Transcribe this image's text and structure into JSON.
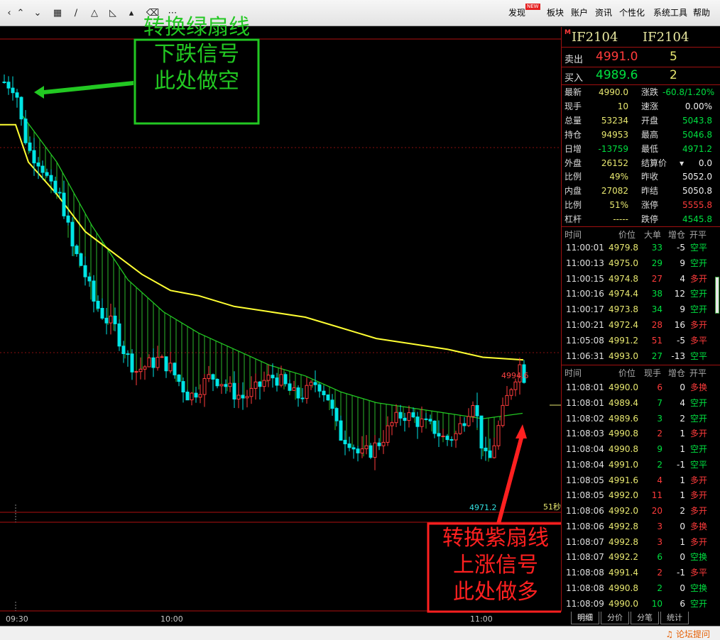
{
  "toolbar": {
    "icons": [
      "collapse-left-icon",
      "arrow-up-double-icon",
      "arrow-down-double-icon",
      "grid-icon",
      "line-draw-icon",
      "triangle-icon",
      "triangle-ruler-icon",
      "eraser-icon",
      "more-icon"
    ],
    "menus": [
      "发现",
      "板块",
      "账户",
      "资讯",
      "个性化",
      "系统工具",
      "帮助"
    ],
    "new_badge": "NEW"
  },
  "chart": {
    "time_labels": [
      "09:30",
      "10:00",
      "11:00"
    ],
    "high_label": "4994.6",
    "low_label": "4971.2",
    "countdown": "51秒",
    "colors": {
      "up": "#ff3b3b",
      "down": "#00e5e5",
      "green_line": "#22c822",
      "yellow_line": "#ffff33",
      "fan": "#2bb82b"
    }
  },
  "annotations": {
    "green": {
      "lines": [
        "转换绿扇线",
        "下跌信号",
        "此处做空"
      ],
      "color": "#22c822"
    },
    "red": {
      "lines": [
        "转换紫扇线",
        "上涨信号",
        "此处做多"
      ],
      "color": "#ff2020"
    }
  },
  "quote": {
    "mark": "M",
    "code": "IF2104",
    "name": "IF2104",
    "sell": {
      "label": "卖出",
      "price": "4991.0",
      "vol": "5"
    },
    "buy": {
      "label": "买入",
      "price": "4989.6",
      "vol": "2"
    },
    "left": [
      {
        "label": "最新",
        "value": "4990.0",
        "color": "#e8e870"
      },
      {
        "label": "现手",
        "value": "10",
        "color": "#e8e870"
      },
      {
        "label": "总量",
        "value": "53234",
        "color": "#e8e870"
      },
      {
        "label": "持仓",
        "value": "94953",
        "color": "#e8e870"
      },
      {
        "label": "日增",
        "value": "-13759",
        "color": "#00e040"
      },
      {
        "label": "外盘",
        "value": "26152",
        "color": "#e8e870"
      },
      {
        "label": "比例",
        "value": "49%",
        "color": "#e8e870"
      },
      {
        "label": "内盘",
        "value": "27082",
        "color": "#e8e870"
      },
      {
        "label": "比例",
        "value": "51%",
        "color": "#e8e870"
      },
      {
        "label": "杠杆",
        "value": "-----",
        "color": "#e8e870"
      }
    ],
    "right": [
      {
        "label": "涨跌",
        "value": "-60.8/1.20%",
        "color": "#00e040"
      },
      {
        "label": "速涨",
        "value": "0.00%",
        "color": "#f0f0f0"
      },
      {
        "label": "开盘",
        "value": "5043.8",
        "color": "#00e040"
      },
      {
        "label": "最高",
        "value": "5046.8",
        "color": "#00e040"
      },
      {
        "label": "最低",
        "value": "4971.2",
        "color": "#00e040"
      },
      {
        "label": "结算价",
        "value": "0.0",
        "color": "#f0f0f0"
      },
      {
        "label": "昨收",
        "value": "5052.0",
        "color": "#f0f0f0"
      },
      {
        "label": "昨结",
        "value": "5050.8",
        "color": "#f0f0f0"
      },
      {
        "label": "涨停",
        "value": "5555.8",
        "color": "#ff3b3b"
      },
      {
        "label": "跌停",
        "value": "4545.8",
        "color": "#00e040"
      }
    ]
  },
  "trades1": {
    "headers": [
      "时间",
      "价位",
      "大单",
      "增仓",
      "开平"
    ],
    "rows": [
      {
        "time": "11:00:01",
        "price": "4979.8",
        "vol": "33",
        "chg": "-5",
        "type": "空平"
      },
      {
        "time": "11:00:13",
        "price": "4975.0",
        "vol": "29",
        "chg": "9",
        "type": "空开"
      },
      {
        "time": "11:00:15",
        "price": "4974.8",
        "vol": "27",
        "chg": "4",
        "type": "多开"
      },
      {
        "time": "11:00:16",
        "price": "4974.4",
        "vol": "38",
        "chg": "12",
        "type": "空开"
      },
      {
        "time": "11:00:17",
        "price": "4973.8",
        "vol": "34",
        "chg": "9",
        "type": "空开"
      },
      {
        "time": "11:00:21",
        "price": "4972.4",
        "vol": "28",
        "chg": "16",
        "type": "多开"
      },
      {
        "time": "11:05:08",
        "price": "4991.2",
        "vol": "51",
        "chg": "-5",
        "type": "多平"
      },
      {
        "time": "11:06:31",
        "price": "4993.0",
        "vol": "27",
        "chg": "-13",
        "type": "空平"
      }
    ]
  },
  "trades2": {
    "headers": [
      "时间",
      "价位",
      "现手",
      "增仓",
      "开平"
    ],
    "rows": [
      {
        "time": "11:08:01",
        "price": "4990.0",
        "vol": "6",
        "chg": "0",
        "type": "多换"
      },
      {
        "time": "11:08:01",
        "price": "4989.4",
        "vol": "7",
        "chg": "4",
        "type": "空开"
      },
      {
        "time": "11:08:02",
        "price": "4989.6",
        "vol": "3",
        "chg": "2",
        "type": "空开"
      },
      {
        "time": "11:08:03",
        "price": "4990.8",
        "vol": "2",
        "chg": "1",
        "type": "多开"
      },
      {
        "time": "11:08:04",
        "price": "4990.8",
        "vol": "9",
        "chg": "1",
        "type": "空开"
      },
      {
        "time": "11:08:04",
        "price": "4991.0",
        "vol": "2",
        "chg": "-1",
        "type": "空平"
      },
      {
        "time": "11:08:05",
        "price": "4991.6",
        "vol": "4",
        "chg": "1",
        "type": "多开"
      },
      {
        "time": "11:08:05",
        "price": "4992.0",
        "vol": "11",
        "chg": "1",
        "type": "多开"
      },
      {
        "time": "11:08:06",
        "price": "4992.0",
        "vol": "20",
        "chg": "2",
        "type": "多开"
      },
      {
        "time": "11:08:06",
        "price": "4992.8",
        "vol": "3",
        "chg": "0",
        "type": "多换"
      },
      {
        "time": "11:08:07",
        "price": "4992.8",
        "vol": "3",
        "chg": "1",
        "type": "多开"
      },
      {
        "time": "11:08:07",
        "price": "4992.2",
        "vol": "6",
        "chg": "0",
        "type": "空换"
      },
      {
        "time": "11:08:08",
        "price": "4991.4",
        "vol": "2",
        "chg": "-1",
        "type": "多平"
      },
      {
        "time": "11:08:08",
        "price": "4990.8",
        "vol": "2",
        "chg": "0",
        "type": "空换"
      },
      {
        "time": "11:08:09",
        "price": "4990.0",
        "vol": "10",
        "chg": "6",
        "type": "空开"
      }
    ]
  },
  "tabs": [
    "明细",
    "分价",
    "分笔",
    "统计"
  ],
  "status": {
    "forum": "论坛提问"
  }
}
